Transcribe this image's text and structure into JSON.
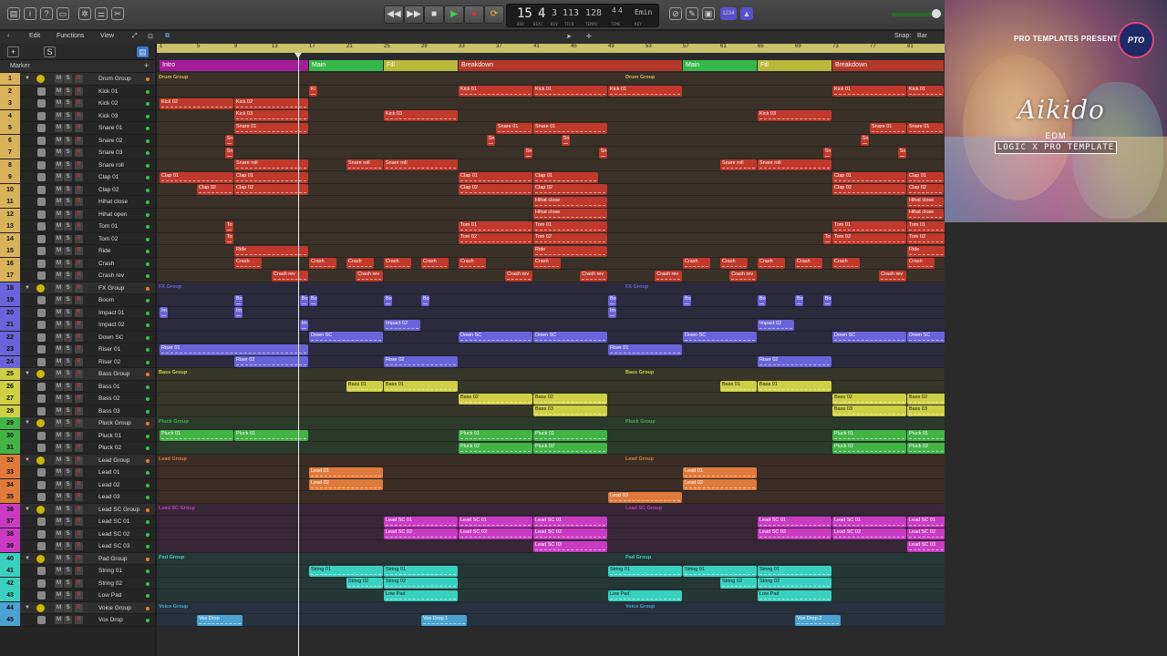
{
  "transport": {
    "bar": "15",
    "beat": "4",
    "division": "3",
    "tick": "113",
    "tempo": "128",
    "sig_top": "4",
    "sig_bottom": "4",
    "key": "Emin",
    "lbl_bar": "BAR",
    "lbl_beat": "BEAT",
    "lbl_div": "DIV",
    "lbl_tick": "TICK",
    "lbl_tempo": "TEMPO",
    "lbl_time": "TIME",
    "lbl_key": "KEY",
    "rewind": "◀◀",
    "forward": "▶▶",
    "stop": "■",
    "play": "▶",
    "record": "●",
    "cycle": "⟳",
    "midi_badge": "1234"
  },
  "menu": {
    "edit": "Edit",
    "functions": "Functions",
    "view": "View",
    "snap_label": "Snap:",
    "snap_value": "Bar"
  },
  "header": {
    "add": "+",
    "s": "S",
    "marker": "Marker"
  },
  "ruler": [
    "1",
    "5",
    "9",
    "13",
    "17",
    "21",
    "25",
    "29",
    "33",
    "37",
    "41",
    "45",
    "49",
    "53",
    "57",
    "61",
    "65",
    "69",
    "73",
    "77",
    "81"
  ],
  "markers": [
    {
      "label": "Intro",
      "start": 1,
      "end": 17,
      "color": "#a51c9a"
    },
    {
      "label": "Main",
      "start": 17,
      "end": 25,
      "color": "#35b84a"
    },
    {
      "label": "Fill",
      "start": 25,
      "end": 33,
      "color": "#b9b83a"
    },
    {
      "label": "Breakdown",
      "start": 33,
      "end": 57,
      "color": "#b33a2a"
    },
    {
      "label": "Main",
      "start": 57,
      "end": 65,
      "color": "#35b84a"
    },
    {
      "label": "Fill",
      "start": 65,
      "end": 73,
      "color": "#b9b83a"
    },
    {
      "label": "Breakdown",
      "start": 73,
      "end": 85,
      "color": "#b33a2a"
    }
  ],
  "groups": {
    "drum": {
      "color": "#d8b25a",
      "bg": "#3a3128"
    },
    "fx": {
      "color": "#6b63d9",
      "bg": "#2c2b3d"
    },
    "bass": {
      "color": "#cfcf45",
      "bg": "#36362a"
    },
    "pluck": {
      "color": "#42b446",
      "bg": "#2b3a2b"
    },
    "lead": {
      "color": "#e07a3a",
      "bg": "#3a2e27"
    },
    "leadsc": {
      "color": "#c93cc2",
      "bg": "#382837"
    },
    "pad": {
      "color": "#3ad0c0",
      "bg": "#263836"
    },
    "voice": {
      "color": "#4aa2d0",
      "bg": "#273240"
    }
  },
  "tracks": [
    {
      "n": "1",
      "name": "Drum Group",
      "g": "drum",
      "type": "group",
      "label": "Drum Group"
    },
    {
      "n": "2",
      "name": "Kick 01",
      "g": "drum"
    },
    {
      "n": "3",
      "name": "Kick 02",
      "g": "drum"
    },
    {
      "n": "4",
      "name": "Kick 03",
      "g": "drum"
    },
    {
      "n": "5",
      "name": "Snare 01",
      "g": "drum"
    },
    {
      "n": "6",
      "name": "Snare 02",
      "g": "drum"
    },
    {
      "n": "7",
      "name": "Snare 03",
      "g": "drum"
    },
    {
      "n": "8",
      "name": "Snare roll",
      "g": "drum"
    },
    {
      "n": "9",
      "name": "Clap 01",
      "g": "drum"
    },
    {
      "n": "10",
      "name": "Clap 02",
      "g": "drum"
    },
    {
      "n": "11",
      "name": "Hihat close",
      "g": "drum"
    },
    {
      "n": "12",
      "name": "Hihat open",
      "g": "drum"
    },
    {
      "n": "13",
      "name": "Tom 01",
      "g": "drum"
    },
    {
      "n": "14",
      "name": "Tom 02",
      "g": "drum"
    },
    {
      "n": "15",
      "name": "Ride",
      "g": "drum"
    },
    {
      "n": "16",
      "name": "Crash",
      "g": "drum"
    },
    {
      "n": "17",
      "name": "Crash rev",
      "g": "drum"
    },
    {
      "n": "18",
      "name": "FX Group",
      "g": "fx",
      "type": "group",
      "label": "FX Group"
    },
    {
      "n": "19",
      "name": "Boom",
      "g": "fx"
    },
    {
      "n": "20",
      "name": "Impact 01",
      "g": "fx"
    },
    {
      "n": "21",
      "name": "Impact 02",
      "g": "fx"
    },
    {
      "n": "22",
      "name": "Down SC",
      "g": "fx"
    },
    {
      "n": "23",
      "name": "Riser 01",
      "g": "fx"
    },
    {
      "n": "24",
      "name": "Riser 02",
      "g": "fx"
    },
    {
      "n": "25",
      "name": "Bass Group",
      "g": "bass",
      "type": "group",
      "label": "Bass Group"
    },
    {
      "n": "26",
      "name": "Bass 01",
      "g": "bass"
    },
    {
      "n": "27",
      "name": "Bass 02",
      "g": "bass"
    },
    {
      "n": "28",
      "name": "Bass 03",
      "g": "bass"
    },
    {
      "n": "29",
      "name": "Pluck Group",
      "g": "pluck",
      "type": "group",
      "label": "Pluck Group"
    },
    {
      "n": "30",
      "name": "Pluck 01",
      "g": "pluck"
    },
    {
      "n": "31",
      "name": "Pluck 02",
      "g": "pluck"
    },
    {
      "n": "32",
      "name": "Lead Group",
      "g": "lead",
      "type": "group",
      "label": "Lead Group"
    },
    {
      "n": "33",
      "name": "Lead 01",
      "g": "lead"
    },
    {
      "n": "34",
      "name": "Lead 02",
      "g": "lead"
    },
    {
      "n": "35",
      "name": "Lead 03",
      "g": "lead"
    },
    {
      "n": "36",
      "name": "Lead SC Group",
      "g": "leadsc",
      "type": "group",
      "label": "Lead SC Group"
    },
    {
      "n": "37",
      "name": "Lead SC 01",
      "g": "leadsc"
    },
    {
      "n": "38",
      "name": "Lead SC 02",
      "g": "leadsc"
    },
    {
      "n": "39",
      "name": "Lead SC 03",
      "g": "leadsc"
    },
    {
      "n": "40",
      "name": "Pad Group",
      "g": "pad",
      "type": "group",
      "label": "Pad Group"
    },
    {
      "n": "41",
      "name": "String 01",
      "g": "pad"
    },
    {
      "n": "42",
      "name": "String 02",
      "g": "pad"
    },
    {
      "n": "43",
      "name": "Low Pad",
      "g": "pad"
    },
    {
      "n": "44",
      "name": "Voice Group",
      "g": "voice",
      "type": "group",
      "label": "Voice Group"
    },
    {
      "n": "45",
      "name": "Vox Drop",
      "g": "voice"
    }
  ],
  "regions": [
    {
      "t": 2,
      "s": 17,
      "e": 18,
      "l": "Ki"
    },
    {
      "t": 2,
      "s": 33,
      "e": 41,
      "l": "Kick 01"
    },
    {
      "t": 2,
      "s": 41,
      "e": 49,
      "l": "Kick 01"
    },
    {
      "t": 2,
      "s": 49,
      "e": 57,
      "l": "Kick 01"
    },
    {
      "t": 2,
      "s": 73,
      "e": 81,
      "l": "Kick 01"
    },
    {
      "t": 2,
      "s": 81,
      "e": 85,
      "l": "Kick 01"
    },
    {
      "t": 3,
      "s": 1,
      "e": 9,
      "l": "Kick 02"
    },
    {
      "t": 3,
      "s": 9,
      "e": 17,
      "l": "Kick 02"
    },
    {
      "t": 4,
      "s": 9,
      "e": 17,
      "l": "Kick 03"
    },
    {
      "t": 4,
      "s": 25,
      "e": 33,
      "l": "Kick 03"
    },
    {
      "t": 4,
      "s": 65,
      "e": 73,
      "l": "Kick 03"
    },
    {
      "t": 5,
      "s": 9,
      "e": 17,
      "l": "Snare 01"
    },
    {
      "t": 5,
      "s": 37,
      "e": 41,
      "l": "Snare 01"
    },
    {
      "t": 5,
      "s": 41,
      "e": 49,
      "l": "Snare 01"
    },
    {
      "t": 5,
      "s": 77,
      "e": 81,
      "l": "Snare 01"
    },
    {
      "t": 5,
      "s": 81,
      "e": 85,
      "l": "Snare 01"
    },
    {
      "t": 6,
      "s": 8,
      "e": 9,
      "l": "Sn"
    },
    {
      "t": 6,
      "s": 36,
      "e": 37,
      "l": "Sn"
    },
    {
      "t": 6,
      "s": 44,
      "e": 45,
      "l": "Sn"
    },
    {
      "t": 6,
      "s": 76,
      "e": 77,
      "l": "Sn"
    },
    {
      "t": 7,
      "s": 8,
      "e": 9,
      "l": "Sn"
    },
    {
      "t": 7,
      "s": 40,
      "e": 41,
      "l": "Sn"
    },
    {
      "t": 7,
      "s": 48,
      "e": 49,
      "l": "Sn"
    },
    {
      "t": 7,
      "s": 72,
      "e": 73,
      "l": "Sn"
    },
    {
      "t": 7,
      "s": 80,
      "e": 81,
      "l": "Sn"
    },
    {
      "t": 8,
      "s": 9,
      "e": 17,
      "l": "Snare roll"
    },
    {
      "t": 8,
      "s": 21,
      "e": 25,
      "l": "Snare roll"
    },
    {
      "t": 8,
      "s": 25,
      "e": 33,
      "l": "Snare roll"
    },
    {
      "t": 8,
      "s": 61,
      "e": 65,
      "l": "Snare roll"
    },
    {
      "t": 8,
      "s": 65,
      "e": 73,
      "l": "Snare roll"
    },
    {
      "t": 9,
      "s": 1,
      "e": 9,
      "l": "Clap 01"
    },
    {
      "t": 9,
      "s": 9,
      "e": 17,
      "l": "Clap 01"
    },
    {
      "t": 9,
      "s": 33,
      "e": 41,
      "l": "Clap 01"
    },
    {
      "t": 9,
      "s": 41,
      "e": 48,
      "l": "Clap 01"
    },
    {
      "t": 9,
      "s": 73,
      "e": 81,
      "l": "Clap 01"
    },
    {
      "t": 9,
      "s": 81,
      "e": 85,
      "l": "Clap 01"
    },
    {
      "t": 10,
      "s": 5,
      "e": 9,
      "l": "Clap 02"
    },
    {
      "t": 10,
      "s": 9,
      "e": 17,
      "l": "Clap 02"
    },
    {
      "t": 10,
      "s": 33,
      "e": 41,
      "l": "Clap 02"
    },
    {
      "t": 10,
      "s": 41,
      "e": 49,
      "l": "Clap 02"
    },
    {
      "t": 10,
      "s": 73,
      "e": 81,
      "l": "Clap 02"
    },
    {
      "t": 10,
      "s": 81,
      "e": 85,
      "l": "Clap 02"
    },
    {
      "t": 11,
      "s": 41,
      "e": 49,
      "l": "Hihat close"
    },
    {
      "t": 11,
      "s": 81,
      "e": 85,
      "l": "Hihat close"
    },
    {
      "t": 12,
      "s": 41,
      "e": 49,
      "l": "Hihat close"
    },
    {
      "t": 12,
      "s": 81,
      "e": 85,
      "l": "Hihat close"
    },
    {
      "t": 13,
      "s": 8,
      "e": 9,
      "l": "To"
    },
    {
      "t": 13,
      "s": 33,
      "e": 41,
      "l": "Tom 01"
    },
    {
      "t": 13,
      "s": 41,
      "e": 49,
      "l": "Tom 01"
    },
    {
      "t": 13,
      "s": 73,
      "e": 81,
      "l": "Tom 01"
    },
    {
      "t": 13,
      "s": 81,
      "e": 89,
      "l": "Tom 01"
    },
    {
      "t": 13,
      "s": 89,
      "e": 97,
      "l": "Tom 01"
    },
    {
      "t": 14,
      "s": 8,
      "e": 9,
      "l": "To"
    },
    {
      "t": 14,
      "s": 33,
      "e": 41,
      "l": "Tom 02"
    },
    {
      "t": 14,
      "s": 41,
      "e": 49,
      "l": "Tom 02"
    },
    {
      "t": 14,
      "s": 72,
      "e": 73,
      "l": "To"
    },
    {
      "t": 14,
      "s": 73,
      "e": 81,
      "l": "Tom 02"
    },
    {
      "t": 14,
      "s": 81,
      "e": 89,
      "l": "Tom 02"
    },
    {
      "t": 14,
      "s": 89,
      "e": 97,
      "l": "Tom 02"
    },
    {
      "t": 15,
      "s": 9,
      "e": 17,
      "l": "Ride"
    },
    {
      "t": 15,
      "s": 41,
      "e": 49,
      "l": "Ride"
    },
    {
      "t": 15,
      "s": 81,
      "e": 89,
      "l": "Ride"
    },
    {
      "t": 15,
      "s": 89,
      "e": 96,
      "l": "Ride"
    },
    {
      "t": 16,
      "s": 9,
      "e": 12,
      "l": "Crash"
    },
    {
      "t": 16,
      "s": 17,
      "e": 20,
      "l": "Crash"
    },
    {
      "t": 16,
      "s": 21,
      "e": 24,
      "l": "Crash"
    },
    {
      "t": 16,
      "s": 25,
      "e": 28,
      "l": "Crash"
    },
    {
      "t": 16,
      "s": 29,
      "e": 32,
      "l": "Crash"
    },
    {
      "t": 16,
      "s": 33,
      "e": 36,
      "l": "Crash"
    },
    {
      "t": 16,
      "s": 41,
      "e": 44,
      "l": "Crash"
    },
    {
      "t": 16,
      "s": 57,
      "e": 60,
      "l": "Crash"
    },
    {
      "t": 16,
      "s": 61,
      "e": 64,
      "l": "Crash"
    },
    {
      "t": 16,
      "s": 65,
      "e": 68,
      "l": "Crash"
    },
    {
      "t": 16,
      "s": 69,
      "e": 72,
      "l": "Crash"
    },
    {
      "t": 16,
      "s": 73,
      "e": 76,
      "l": "Crash"
    },
    {
      "t": 16,
      "s": 81,
      "e": 84,
      "l": "Crash"
    },
    {
      "t": 17,
      "s": 13,
      "e": 17,
      "l": "Crash rev"
    },
    {
      "t": 17,
      "s": 22,
      "e": 25,
      "l": "Crash rev"
    },
    {
      "t": 17,
      "s": 38,
      "e": 41,
      "l": "Crash rev"
    },
    {
      "t": 17,
      "s": 46,
      "e": 49,
      "l": "Crash rev"
    },
    {
      "t": 17,
      "s": 54,
      "e": 57,
      "l": "Crash rev"
    },
    {
      "t": 17,
      "s": 62,
      "e": 65,
      "l": "Crash rev"
    },
    {
      "t": 17,
      "s": 78,
      "e": 81,
      "l": "Crash rev"
    },
    {
      "t": 19,
      "s": 9,
      "e": 10,
      "l": "Bo"
    },
    {
      "t": 19,
      "s": 16,
      "e": 17,
      "l": "Bo"
    },
    {
      "t": 19,
      "s": 17,
      "e": 18,
      "l": "Bo"
    },
    {
      "t": 19,
      "s": 25,
      "e": 26,
      "l": "Bo"
    },
    {
      "t": 19,
      "s": 29,
      "e": 30,
      "l": "Bo"
    },
    {
      "t": 19,
      "s": 49,
      "e": 50,
      "l": "Bo"
    },
    {
      "t": 19,
      "s": 57,
      "e": 58,
      "l": "Bo"
    },
    {
      "t": 19,
      "s": 65,
      "e": 66,
      "l": "Bo"
    },
    {
      "t": 19,
      "s": 69,
      "e": 70,
      "l": "Bo"
    },
    {
      "t": 19,
      "s": 72,
      "e": 73,
      "l": "Bo"
    },
    {
      "t": 20,
      "s": 1,
      "e": 2,
      "l": "Im"
    },
    {
      "t": 20,
      "s": 9,
      "e": 10,
      "l": "Im"
    },
    {
      "t": 20,
      "s": 49,
      "e": 50,
      "l": "Im"
    },
    {
      "t": 21,
      "s": 16,
      "e": 17,
      "l": "Im"
    },
    {
      "t": 21,
      "s": 25,
      "e": 29,
      "l": "Impact 02"
    },
    {
      "t": 21,
      "s": 65,
      "e": 69,
      "l": "Impact 02"
    },
    {
      "t": 22,
      "s": 17,
      "e": 25,
      "l": "Down SC"
    },
    {
      "t": 22,
      "s": 33,
      "e": 41,
      "l": "Down SC"
    },
    {
      "t": 22,
      "s": 41,
      "e": 49,
      "l": "Down SC"
    },
    {
      "t": 22,
      "s": 57,
      "e": 65,
      "l": "Down SC"
    },
    {
      "t": 22,
      "s": 73,
      "e": 81,
      "l": "Down SC"
    },
    {
      "t": 22,
      "s": 81,
      "e": 89,
      "l": "Down SC"
    },
    {
      "t": 23,
      "s": 1,
      "e": 17,
      "l": "Riser 01"
    },
    {
      "t": 23,
      "s": 49,
      "e": 57,
      "l": "Riser 01"
    },
    {
      "t": 23,
      "s": 89,
      "e": 104,
      "l": "Riser 01"
    },
    {
      "t": 24,
      "s": 9,
      "e": 17,
      "l": "Riser 02"
    },
    {
      "t": 24,
      "s": 25,
      "e": 33,
      "l": "Riser 02"
    },
    {
      "t": 24,
      "s": 65,
      "e": 73,
      "l": "Riser 02"
    },
    {
      "t": 26,
      "s": 21,
      "e": 25,
      "l": "Bass 01"
    },
    {
      "t": 26,
      "s": 25,
      "e": 33,
      "l": "Bass 01"
    },
    {
      "t": 26,
      "s": 61,
      "e": 65,
      "l": "Bass 01"
    },
    {
      "t": 26,
      "s": 65,
      "e": 73,
      "l": "Bass 01"
    },
    {
      "t": 27,
      "s": 33,
      "e": 41,
      "l": "Bass 02"
    },
    {
      "t": 27,
      "s": 41,
      "e": 49,
      "l": "Bass 02"
    },
    {
      "t": 27,
      "s": 73,
      "e": 81,
      "l": "Bass 02"
    },
    {
      "t": 27,
      "s": 81,
      "e": 88,
      "l": "Bass 02"
    },
    {
      "t": 28,
      "s": 41,
      "e": 49,
      "l": "Bass 03"
    },
    {
      "t": 28,
      "s": 73,
      "e": 81,
      "l": "Bass 03"
    },
    {
      "t": 28,
      "s": 81,
      "e": 88,
      "l": "Bass 03"
    },
    {
      "t": 30,
      "s": 1,
      "e": 9,
      "l": "Pluck 01"
    },
    {
      "t": 30,
      "s": 9,
      "e": 17,
      "l": "Pluck 01"
    },
    {
      "t": 30,
      "s": 33,
      "e": 41,
      "l": "Pluck 01"
    },
    {
      "t": 30,
      "s": 41,
      "e": 49,
      "l": "Pluck 01"
    },
    {
      "t": 30,
      "s": 73,
      "e": 81,
      "l": "Pluck 01"
    },
    {
      "t": 30,
      "s": 81,
      "e": 89,
      "l": "Pluck 01"
    },
    {
      "t": 30,
      "s": 89,
      "e": 97,
      "l": "Pluck 01"
    },
    {
      "t": 31,
      "s": 33,
      "e": 41,
      "l": "Pluck 02"
    },
    {
      "t": 31,
      "s": 41,
      "e": 49,
      "l": "Pluck 02"
    },
    {
      "t": 31,
      "s": 73,
      "e": 81,
      "l": "Pluck 02"
    },
    {
      "t": 31,
      "s": 81,
      "e": 89,
      "l": "Pluck 02"
    },
    {
      "t": 33,
      "s": 17,
      "e": 25,
      "l": "Lead 01"
    },
    {
      "t": 33,
      "s": 57,
      "e": 65,
      "l": "Lead 01"
    },
    {
      "t": 34,
      "s": 17,
      "e": 25,
      "l": "Lead 02"
    },
    {
      "t": 34,
      "s": 57,
      "e": 65,
      "l": "Lead 02"
    },
    {
      "t": 35,
      "s": 49,
      "e": 57,
      "l": "Lead 03"
    },
    {
      "t": 35,
      "s": 89,
      "e": 97,
      "l": "Lead 03"
    },
    {
      "t": 37,
      "s": 25,
      "e": 33,
      "l": "Lead SC 01"
    },
    {
      "t": 37,
      "s": 33,
      "e": 41,
      "l": "Lead SC 01"
    },
    {
      "t": 37,
      "s": 41,
      "e": 49,
      "l": "Lead SC 01"
    },
    {
      "t": 37,
      "s": 65,
      "e": 73,
      "l": "Lead SC 01"
    },
    {
      "t": 37,
      "s": 73,
      "e": 81,
      "l": "Lead SC 01"
    },
    {
      "t": 37,
      "s": 81,
      "e": 89,
      "l": "Lead SC 01"
    },
    {
      "t": 38,
      "s": 25,
      "e": 33,
      "l": "Lead SC 02"
    },
    {
      "t": 38,
      "s": 33,
      "e": 41,
      "l": "Lead SC 02"
    },
    {
      "t": 38,
      "s": 41,
      "e": 49,
      "l": "Lead SC 02"
    },
    {
      "t": 38,
      "s": 65,
      "e": 73,
      "l": "Lead SC 02"
    },
    {
      "t": 38,
      "s": 73,
      "e": 81,
      "l": "Lead SC 02"
    },
    {
      "t": 38,
      "s": 81,
      "e": 89,
      "l": "Lead SC 02"
    },
    {
      "t": 39,
      "s": 41,
      "e": 49,
      "l": "Lead SC 03"
    },
    {
      "t": 39,
      "s": 81,
      "e": 89,
      "l": "Lead SC 03"
    },
    {
      "t": 41,
      "s": 17,
      "e": 25,
      "l": "String 01"
    },
    {
      "t": 41,
      "s": 25,
      "e": 33,
      "l": "String 01"
    },
    {
      "t": 41,
      "s": 49,
      "e": 57,
      "l": "String 01"
    },
    {
      "t": 41,
      "s": 57,
      "e": 65,
      "l": "String 01"
    },
    {
      "t": 41,
      "s": 65,
      "e": 73,
      "l": "String 01"
    },
    {
      "t": 42,
      "s": 21,
      "e": 25,
      "l": "String 02"
    },
    {
      "t": 42,
      "s": 25,
      "e": 33,
      "l": "String 02"
    },
    {
      "t": 42,
      "s": 61,
      "e": 65,
      "l": "String 02"
    },
    {
      "t": 42,
      "s": 65,
      "e": 73,
      "l": "String 02"
    },
    {
      "t": 43,
      "s": 25,
      "e": 33,
      "l": "Low Pad"
    },
    {
      "t": 43,
      "s": 49,
      "e": 57,
      "l": "Low Pad"
    },
    {
      "t": 43,
      "s": 65,
      "e": 73,
      "l": "Low Pad"
    },
    {
      "t": 45,
      "s": 5,
      "e": 10,
      "l": "Vox Drop"
    },
    {
      "t": 45,
      "s": 29,
      "e": 34,
      "l": "Vox Drop.1"
    },
    {
      "t": 45,
      "s": 69,
      "e": 74,
      "l": "Vox Drop.2"
    },
    {
      "t": 45,
      "s": 93,
      "e": 98,
      "l": "Vox Drop.3"
    }
  ],
  "art": {
    "presents": "PRO TEMPLATES PRESENTS",
    "logo": "PTO",
    "title": "Aikido",
    "genre": "EDM",
    "subtitle": "LOGIC X PRO TEMPLATE"
  }
}
